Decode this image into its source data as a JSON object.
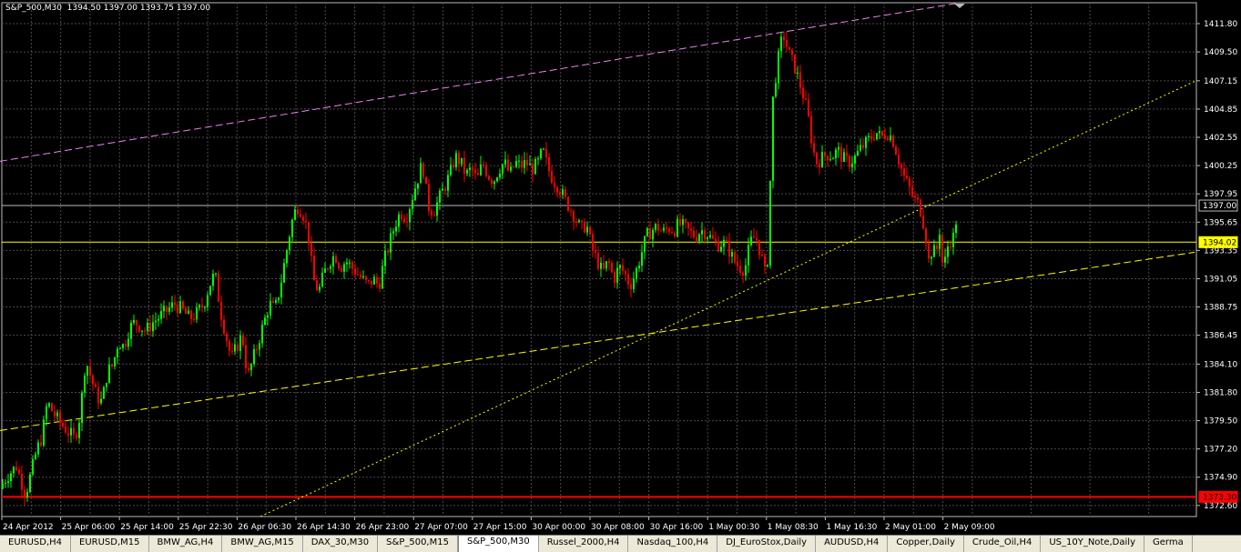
{
  "header": {
    "symbol": "S&P_500,M30",
    "ohlc": "1394.50 1397.00 1393.75 1397.00"
  },
  "tabs": [
    {
      "label": "EURUSD,H4",
      "active": false
    },
    {
      "label": "EURUSD,M15",
      "active": false
    },
    {
      "label": "BMW_AG,H4",
      "active": false
    },
    {
      "label": "BMW_AG,M15",
      "active": false
    },
    {
      "label": "DAX_30,M30",
      "active": false
    },
    {
      "label": "S&P_500,M15",
      "active": false
    },
    {
      "label": "S&P_500,M30",
      "active": true
    },
    {
      "label": "Russel_2000,H4",
      "active": false
    },
    {
      "label": "Nasdaq_100,H4",
      "active": false
    },
    {
      "label": "DJ_EuroStox,Daily",
      "active": false
    },
    {
      "label": "AUDUSD,H4",
      "active": false
    },
    {
      "label": "Copper,Daily",
      "active": false
    },
    {
      "label": "Crude_Oil,H4",
      "active": false
    },
    {
      "label": "US_10Y_Note,Daily",
      "active": false
    },
    {
      "label": "Germa",
      "active": false
    }
  ],
  "colors": {
    "background": "#000000",
    "grid": "#4a4a4a",
    "bull": "#00ff00",
    "bear": "#ff0000",
    "text": "#ffffff",
    "bid_line": "#ffff00",
    "support_line": "#ff0000",
    "channel_line": "#ee82ee",
    "trend_line": "#ffff00"
  },
  "chart_data": {
    "type": "candlestick",
    "ylim": [
      1371.7,
      1413.5
    ],
    "y_ticks": [
      "1411.80",
      "1409.50",
      "1407.15",
      "1404.85",
      "1402.55",
      "1400.25",
      "1397.95",
      "1395.65",
      "1393.35",
      "1391.05",
      "1388.75",
      "1386.45",
      "1384.10",
      "1381.80",
      "1379.50",
      "1377.20",
      "1374.90",
      "1372.60"
    ],
    "x_ticks": [
      "24 Apr 2012",
      "25 Apr 06:00",
      "25 Apr 14:00",
      "25 Apr 22:30",
      "26 Apr 06:30",
      "26 Apr 14:30",
      "26 Apr 23:00",
      "27 Apr 07:00",
      "27 Apr 15:00",
      "30 Apr 00:00",
      "30 Apr 08:00",
      "30 Apr 16:00",
      "1 May 00:30",
      "1 May 08:30",
      "1 May 16:30",
      "2 May 01:00",
      "2 May 09:00"
    ],
    "price_labels": {
      "last": "1397.00",
      "bid": "1394.02",
      "support": "1373.30"
    },
    "levels": {
      "last": 1397.0,
      "bid": 1394.02,
      "support": 1373.3
    },
    "trend_lines": [
      {
        "name": "channel",
        "style": "dashed",
        "p1": [
          0,
          1400.6
        ],
        "p2": [
          1055,
          1413.5
        ]
      },
      {
        "name": "lower-trend",
        "style": "dashed",
        "p1": [
          0,
          1378.7
        ],
        "p2": [
          1312,
          1393.2
        ]
      },
      {
        "name": "rising-trend",
        "style": "dotted",
        "p1": [
          286,
          1371.7
        ],
        "p2": [
          1312,
          1407.1
        ]
      }
    ],
    "close_path": [
      [
        0,
        1374.0
      ],
      [
        8,
        1375.0
      ],
      [
        18,
        1375.8
      ],
      [
        28,
        1373.5
      ],
      [
        34,
        1375.2
      ],
      [
        40,
        1377.0
      ],
      [
        46,
        1378.2
      ],
      [
        52,
        1381.0
      ],
      [
        58,
        1380.2
      ],
      [
        64,
        1379.5
      ],
      [
        70,
        1379.0
      ],
      [
        76,
        1378.5
      ],
      [
        82,
        1378.0
      ],
      [
        88,
        1380.0
      ],
      [
        94,
        1384.5
      ],
      [
        100,
        1383.0
      ],
      [
        106,
        1381.5
      ],
      [
        112,
        1381.0
      ],
      [
        118,
        1383.5
      ],
      [
        124,
        1384.0
      ],
      [
        130,
        1386.0
      ],
      [
        136,
        1385.5
      ],
      [
        142,
        1387.0
      ],
      [
        148,
        1387.5
      ],
      [
        154,
        1387.2
      ],
      [
        160,
        1386.8
      ],
      [
        168,
        1387.5
      ],
      [
        176,
        1388.0
      ],
      [
        184,
        1388.5
      ],
      [
        192,
        1389.0
      ],
      [
        200,
        1388.5
      ],
      [
        208,
        1387.8
      ],
      [
        216,
        1388.2
      ],
      [
        224,
        1389.0
      ],
      [
        230,
        1390.5
      ],
      [
        236,
        1391.5
      ],
      [
        242,
        1388.5
      ],
      [
        248,
        1386.5
      ],
      [
        254,
        1384.5
      ],
      [
        260,
        1385.5
      ],
      [
        266,
        1386.5
      ],
      [
        272,
        1383.0
      ],
      [
        278,
        1384.5
      ],
      [
        284,
        1386.0
      ],
      [
        290,
        1387.5
      ],
      [
        296,
        1389.0
      ],
      [
        302,
        1388.5
      ],
      [
        308,
        1390.5
      ],
      [
        314,
        1393.0
      ],
      [
        320,
        1395.5
      ],
      [
        326,
        1397.0
      ],
      [
        332,
        1396.5
      ],
      [
        338,
        1395.0
      ],
      [
        344,
        1391.0
      ],
      [
        350,
        1390.0
      ],
      [
        356,
        1391.5
      ],
      [
        362,
        1392.5
      ],
      [
        368,
        1393.0
      ],
      [
        374,
        1392.0
      ],
      [
        380,
        1392.5
      ],
      [
        386,
        1392.0
      ],
      [
        392,
        1391.5
      ],
      [
        398,
        1391.0
      ],
      [
        404,
        1390.5
      ],
      [
        410,
        1391.0
      ],
      [
        416,
        1390.5
      ],
      [
        422,
        1392.5
      ],
      [
        428,
        1394.0
      ],
      [
        434,
        1395.5
      ],
      [
        440,
        1396.5
      ],
      [
        446,
        1396.0
      ],
      [
        452,
        1397.5
      ],
      [
        458,
        1399.0
      ],
      [
        464,
        1400.5
      ],
      [
        470,
        1397.0
      ],
      [
        476,
        1396.5
      ],
      [
        482,
        1397.5
      ],
      [
        488,
        1398.5
      ],
      [
        494,
        1399.5
      ],
      [
        500,
        1401.0
      ],
      [
        506,
        1400.5
      ],
      [
        512,
        1399.5
      ],
      [
        518,
        1400.0
      ],
      [
        524,
        1399.0
      ],
      [
        530,
        1400.5
      ],
      [
        536,
        1399.5
      ],
      [
        542,
        1399.0
      ],
      [
        548,
        1400.0
      ],
      [
        554,
        1400.5
      ],
      [
        560,
        1399.5
      ],
      [
        566,
        1400.5
      ],
      [
        572,
        1400.2
      ],
      [
        578,
        1400.5
      ],
      [
        584,
        1400.0
      ],
      [
        590,
        1400.3
      ],
      [
        596,
        1401.5
      ],
      [
        602,
        1400.0
      ],
      [
        608,
        1399.0
      ],
      [
        614,
        1398.5
      ],
      [
        620,
        1397.5
      ],
      [
        626,
        1396.8
      ],
      [
        632,
        1396.0
      ],
      [
        638,
        1395.0
      ],
      [
        644,
        1395.5
      ],
      [
        650,
        1393.5
      ],
      [
        656,
        1392.5
      ],
      [
        662,
        1391.5
      ],
      [
        668,
        1392.5
      ],
      [
        674,
        1391.0
      ],
      [
        680,
        1392.0
      ],
      [
        686,
        1391.5
      ],
      [
        692,
        1390.5
      ],
      [
        698,
        1391.5
      ],
      [
        704,
        1393.0
      ],
      [
        710,
        1394.5
      ],
      [
        716,
        1395.0
      ],
      [
        722,
        1395.3
      ],
      [
        728,
        1394.8
      ],
      [
        734,
        1395.2
      ],
      [
        740,
        1395.0
      ],
      [
        746,
        1395.5
      ],
      [
        752,
        1395.2
      ],
      [
        758,
        1394.8
      ],
      [
        764,
        1394.5
      ],
      [
        770,
        1395.0
      ],
      [
        776,
        1394.8
      ],
      [
        782,
        1394.2
      ],
      [
        788,
        1393.8
      ],
      [
        794,
        1394.0
      ],
      [
        800,
        1393.5
      ],
      [
        806,
        1392.5
      ],
      [
        812,
        1392.0
      ],
      [
        818,
        1391.8
      ],
      [
        824,
        1394.0
      ],
      [
        830,
        1394.5
      ],
      [
        836,
        1393.0
      ],
      [
        840,
        1391.5
      ],
      [
        844,
        1393.0
      ],
      [
        848,
        1405.0
      ],
      [
        852,
        1407.5
      ],
      [
        856,
        1409.5
      ],
      [
        860,
        1411.0
      ],
      [
        864,
        1410.0
      ],
      [
        868,
        1409.0
      ],
      [
        872,
        1408.5
      ],
      [
        876,
        1407.5
      ],
      [
        880,
        1406.5
      ],
      [
        884,
        1405.5
      ],
      [
        888,
        1404.0
      ],
      [
        892,
        1402.0
      ],
      [
        896,
        1400.5
      ],
      [
        902,
        1400.8
      ],
      [
        908,
        1401.2
      ],
      [
        914,
        1401.0
      ],
      [
        920,
        1401.5
      ],
      [
        926,
        1400.8
      ],
      [
        932,
        1400.5
      ],
      [
        938,
        1400.8
      ],
      [
        944,
        1401.5
      ],
      [
        950,
        1402.0
      ],
      [
        956,
        1402.5
      ],
      [
        962,
        1403.0
      ],
      [
        968,
        1402.5
      ],
      [
        974,
        1403.0
      ],
      [
        980,
        1402.5
      ],
      [
        986,
        1401.0
      ],
      [
        992,
        1399.5
      ],
      [
        998,
        1398.5
      ],
      [
        1004,
        1397.5
      ],
      [
        1010,
        1397.0
      ],
      [
        1016,
        1395.0
      ],
      [
        1020,
        1392.5
      ],
      [
        1024,
        1393.5
      ],
      [
        1028,
        1393.0
      ],
      [
        1032,
        1395.0
      ],
      [
        1036,
        1391.5
      ],
      [
        1040,
        1393.5
      ],
      [
        1044,
        1394.2
      ],
      [
        1048,
        1394.5
      ],
      [
        1052,
        1397.0
      ]
    ]
  }
}
